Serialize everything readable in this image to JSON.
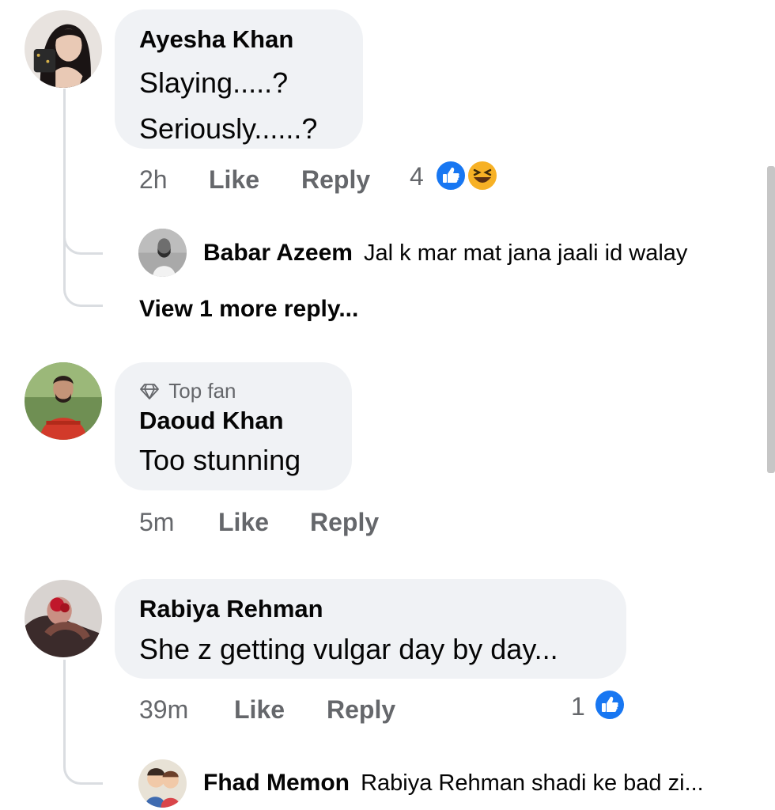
{
  "comments": [
    {
      "author": "Ayesha Khan",
      "lines": [
        "Slaying.....?",
        "Seriously......?"
      ],
      "time": "2h",
      "like_label": "Like",
      "reply_label": "Reply",
      "reaction_count": "4",
      "reactions": [
        "like-icon",
        "haha-icon"
      ],
      "replies": [
        {
          "author": "Babar Azeem",
          "text": "Jal k mar mat jana jaali id walay"
        }
      ],
      "view_more": "View 1 more reply..."
    },
    {
      "badge": "Top fan",
      "author": "Daoud Khan",
      "lines": [
        "Too stunning"
      ],
      "time": "5m",
      "like_label": "Like",
      "reply_label": "Reply"
    },
    {
      "author": "Rabiya Rehman",
      "lines": [
        "She z getting vulgar day by day..."
      ],
      "time": "39m",
      "like_label": "Like",
      "reply_label": "Reply",
      "reaction_count": "1",
      "reactions": [
        "like-icon"
      ],
      "replies": [
        {
          "author": "Fhad Memon",
          "text": "Rabiya Rehman shadi ke bad zi..."
        }
      ]
    }
  ],
  "colors": {
    "bubble": "#f0f2f5",
    "meta_text": "#65676b",
    "like_blue": "#1877f2",
    "haha_yellow": "#f7b125"
  }
}
